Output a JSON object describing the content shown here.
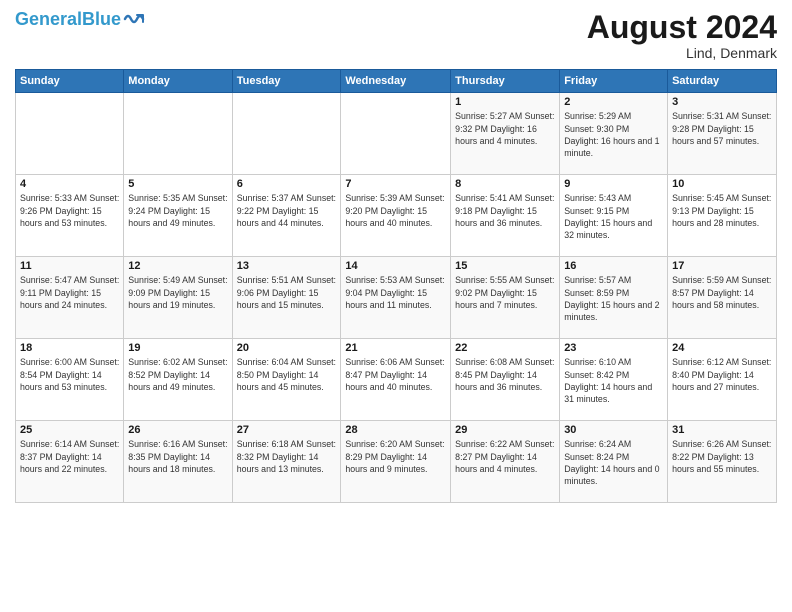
{
  "header": {
    "logo_general": "General",
    "logo_blue": "Blue",
    "month_year": "August 2024",
    "location": "Lind, Denmark"
  },
  "days_of_week": [
    "Sunday",
    "Monday",
    "Tuesday",
    "Wednesday",
    "Thursday",
    "Friday",
    "Saturday"
  ],
  "weeks": [
    [
      {
        "day": "",
        "info": ""
      },
      {
        "day": "",
        "info": ""
      },
      {
        "day": "",
        "info": ""
      },
      {
        "day": "",
        "info": ""
      },
      {
        "day": "1",
        "info": "Sunrise: 5:27 AM\nSunset: 9:32 PM\nDaylight: 16 hours\nand 4 minutes."
      },
      {
        "day": "2",
        "info": "Sunrise: 5:29 AM\nSunset: 9:30 PM\nDaylight: 16 hours\nand 1 minute."
      },
      {
        "day": "3",
        "info": "Sunrise: 5:31 AM\nSunset: 9:28 PM\nDaylight: 15 hours\nand 57 minutes."
      }
    ],
    [
      {
        "day": "4",
        "info": "Sunrise: 5:33 AM\nSunset: 9:26 PM\nDaylight: 15 hours\nand 53 minutes."
      },
      {
        "day": "5",
        "info": "Sunrise: 5:35 AM\nSunset: 9:24 PM\nDaylight: 15 hours\nand 49 minutes."
      },
      {
        "day": "6",
        "info": "Sunrise: 5:37 AM\nSunset: 9:22 PM\nDaylight: 15 hours\nand 44 minutes."
      },
      {
        "day": "7",
        "info": "Sunrise: 5:39 AM\nSunset: 9:20 PM\nDaylight: 15 hours\nand 40 minutes."
      },
      {
        "day": "8",
        "info": "Sunrise: 5:41 AM\nSunset: 9:18 PM\nDaylight: 15 hours\nand 36 minutes."
      },
      {
        "day": "9",
        "info": "Sunrise: 5:43 AM\nSunset: 9:15 PM\nDaylight: 15 hours\nand 32 minutes."
      },
      {
        "day": "10",
        "info": "Sunrise: 5:45 AM\nSunset: 9:13 PM\nDaylight: 15 hours\nand 28 minutes."
      }
    ],
    [
      {
        "day": "11",
        "info": "Sunrise: 5:47 AM\nSunset: 9:11 PM\nDaylight: 15 hours\nand 24 minutes."
      },
      {
        "day": "12",
        "info": "Sunrise: 5:49 AM\nSunset: 9:09 PM\nDaylight: 15 hours\nand 19 minutes."
      },
      {
        "day": "13",
        "info": "Sunrise: 5:51 AM\nSunset: 9:06 PM\nDaylight: 15 hours\nand 15 minutes."
      },
      {
        "day": "14",
        "info": "Sunrise: 5:53 AM\nSunset: 9:04 PM\nDaylight: 15 hours\nand 11 minutes."
      },
      {
        "day": "15",
        "info": "Sunrise: 5:55 AM\nSunset: 9:02 PM\nDaylight: 15 hours\nand 7 minutes."
      },
      {
        "day": "16",
        "info": "Sunrise: 5:57 AM\nSunset: 8:59 PM\nDaylight: 15 hours\nand 2 minutes."
      },
      {
        "day": "17",
        "info": "Sunrise: 5:59 AM\nSunset: 8:57 PM\nDaylight: 14 hours\nand 58 minutes."
      }
    ],
    [
      {
        "day": "18",
        "info": "Sunrise: 6:00 AM\nSunset: 8:54 PM\nDaylight: 14 hours\nand 53 minutes."
      },
      {
        "day": "19",
        "info": "Sunrise: 6:02 AM\nSunset: 8:52 PM\nDaylight: 14 hours\nand 49 minutes."
      },
      {
        "day": "20",
        "info": "Sunrise: 6:04 AM\nSunset: 8:50 PM\nDaylight: 14 hours\nand 45 minutes."
      },
      {
        "day": "21",
        "info": "Sunrise: 6:06 AM\nSunset: 8:47 PM\nDaylight: 14 hours\nand 40 minutes."
      },
      {
        "day": "22",
        "info": "Sunrise: 6:08 AM\nSunset: 8:45 PM\nDaylight: 14 hours\nand 36 minutes."
      },
      {
        "day": "23",
        "info": "Sunrise: 6:10 AM\nSunset: 8:42 PM\nDaylight: 14 hours\nand 31 minutes."
      },
      {
        "day": "24",
        "info": "Sunrise: 6:12 AM\nSunset: 8:40 PM\nDaylight: 14 hours\nand 27 minutes."
      }
    ],
    [
      {
        "day": "25",
        "info": "Sunrise: 6:14 AM\nSunset: 8:37 PM\nDaylight: 14 hours\nand 22 minutes."
      },
      {
        "day": "26",
        "info": "Sunrise: 6:16 AM\nSunset: 8:35 PM\nDaylight: 14 hours\nand 18 minutes."
      },
      {
        "day": "27",
        "info": "Sunrise: 6:18 AM\nSunset: 8:32 PM\nDaylight: 14 hours\nand 13 minutes."
      },
      {
        "day": "28",
        "info": "Sunrise: 6:20 AM\nSunset: 8:29 PM\nDaylight: 14 hours\nand 9 minutes."
      },
      {
        "day": "29",
        "info": "Sunrise: 6:22 AM\nSunset: 8:27 PM\nDaylight: 14 hours\nand 4 minutes."
      },
      {
        "day": "30",
        "info": "Sunrise: 6:24 AM\nSunset: 8:24 PM\nDaylight: 14 hours\nand 0 minutes."
      },
      {
        "day": "31",
        "info": "Sunrise: 6:26 AM\nSunset: 8:22 PM\nDaylight: 13 hours\nand 55 minutes."
      }
    ]
  ]
}
